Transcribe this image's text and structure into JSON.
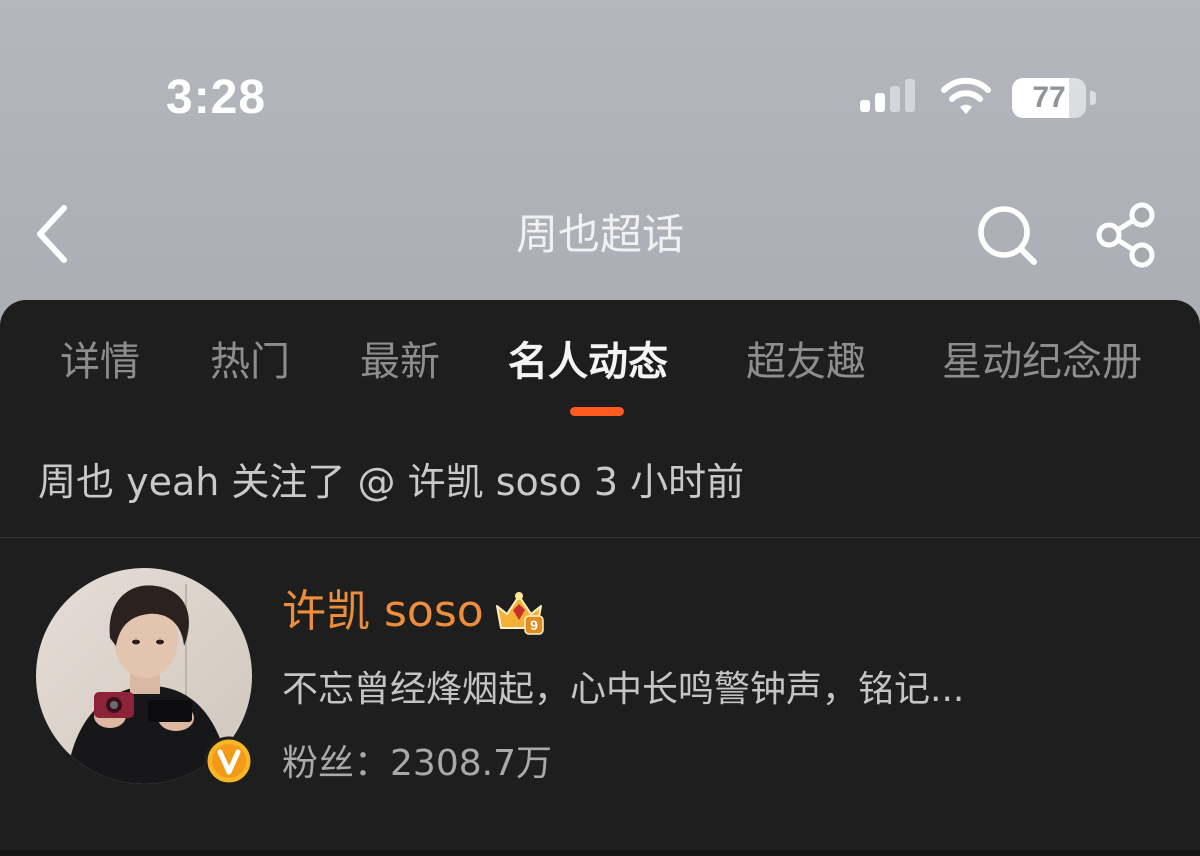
{
  "status_bar": {
    "time": "3:28",
    "battery_level": "77",
    "battery_fraction": 0.77
  },
  "nav": {
    "back_icon": "chevron-left-icon",
    "title": "周也超话",
    "search_icon": "search-icon",
    "share_icon": "share-icon"
  },
  "tabs": [
    {
      "label": "详情"
    },
    {
      "label": "热门"
    },
    {
      "label": "最新"
    },
    {
      "label": "名人动态",
      "active": true
    },
    {
      "label": "超友趣"
    },
    {
      "label": "星动纪念册"
    }
  ],
  "activity": {
    "actor": "周也 yeah",
    "action": "关注了",
    "target": "@ 许凯 soso",
    "time": "3 小时前"
  },
  "user_card": {
    "name": "许凯 soso",
    "bio": "不忘曾经烽烟起，心中长鸣警钟声，铭记...",
    "fans_label": "粉丝：",
    "fans_count": "2308.7万",
    "verified_icon": "verified-v-icon",
    "level_badge": "crown-level-icon",
    "level_number": "9"
  },
  "colors": {
    "accent": "#ff5a1f",
    "username": "#ee8e3a",
    "panel_bg": "#1e1e1e"
  }
}
